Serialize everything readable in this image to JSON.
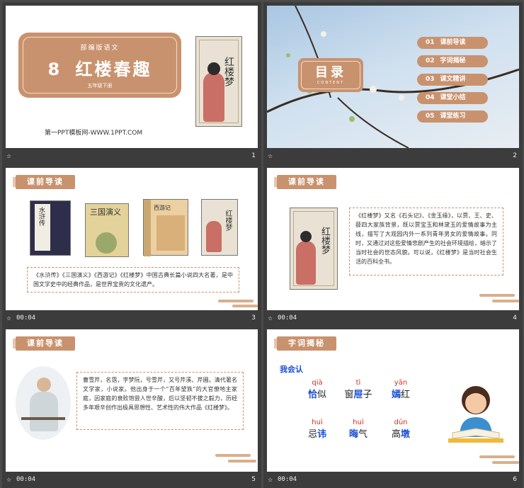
{
  "slides": [
    {
      "num": "1",
      "small_title": "部编版语文",
      "lesson_no": "8",
      "title": "红楼春趣",
      "grade": "五年级下册",
      "website": "第一PPT模板网-WWW.1PPT.COM",
      "book_title": "红楼梦"
    },
    {
      "num": "2",
      "toc_title": "目录",
      "toc_sub": "CONTENT",
      "items": [
        {
          "no": "01",
          "label": "课前导读"
        },
        {
          "no": "02",
          "label": "字词揭秘"
        },
        {
          "no": "03",
          "label": "课文精讲"
        },
        {
          "no": "04",
          "label": "课堂小结"
        },
        {
          "no": "05",
          "label": "课堂练习"
        }
      ]
    },
    {
      "num": "3",
      "time": "00:04",
      "badge": "课前导读",
      "books": [
        "水浒传",
        "三国演义",
        "西游记",
        "红楼梦"
      ],
      "caption": "《水浒传》《三国演义》《西游记》《红楼梦》中国古典长篇小说四大名著，是中国文学史中的经典作品，是世界宝贵的文化遗产。"
    },
    {
      "num": "4",
      "time": "00:04",
      "badge": "课前导读",
      "book_title": "红楼梦",
      "text": "《红楼梦》又名《石头记》、《金玉缘》，以贾、王、史、薛四大家族背景，既以贾宝玉和林黛玉的爱情故事为主线，描写了大观园内外一系列青年男女的爱情故事。同时，又通过对这些爱情悲剧产生的社会环境描绘，暗示了当时社会的世态风貌。可以说，《红楼梦》是当时社会生活的百科全书。"
    },
    {
      "num": "5",
      "time": "00:04",
      "badge": "课前导读",
      "text": "曹雪芹，名霑，字梦阮，号雪芹，又号芹溪、芹圃。清代著名文学家，小说家。他出身于一个“百年望族”的大官僚地主家庭，因家庭的衰败饱尝人世辛酸，后以坚韧不拔之毅力，历经多年艰辛创作出极具思想性、艺术性的伟大作品《红楼梦》。"
    },
    {
      "num": "6",
      "time": "00:04",
      "badge": "字词揭秘",
      "heading": "我会认",
      "words": [
        {
          "pinyin": "qià",
          "pre": "",
          "hl": "恰",
          "post": "似"
        },
        {
          "pinyin": "tì",
          "pre": "窗",
          "hl": "屉",
          "post": "子"
        },
        {
          "pinyin": "yān",
          "pre": "",
          "hl": "嫣",
          "post": "红"
        },
        {
          "pinyin": "huì",
          "pre": "忌",
          "hl": "讳",
          "post": ""
        },
        {
          "pinyin": "huì",
          "pre": "",
          "hl": "晦",
          "post": "气"
        },
        {
          "pinyin": "dūn",
          "pre": "高",
          "hl": "墩",
          "post": ""
        }
      ]
    }
  ],
  "colors": {
    "accent": "#c9926e",
    "highlight_blue": "#1a4fd6",
    "pinyin_red": "#d0301f"
  },
  "icons": [
    "star-icon",
    "girl-reading-illustration"
  ]
}
